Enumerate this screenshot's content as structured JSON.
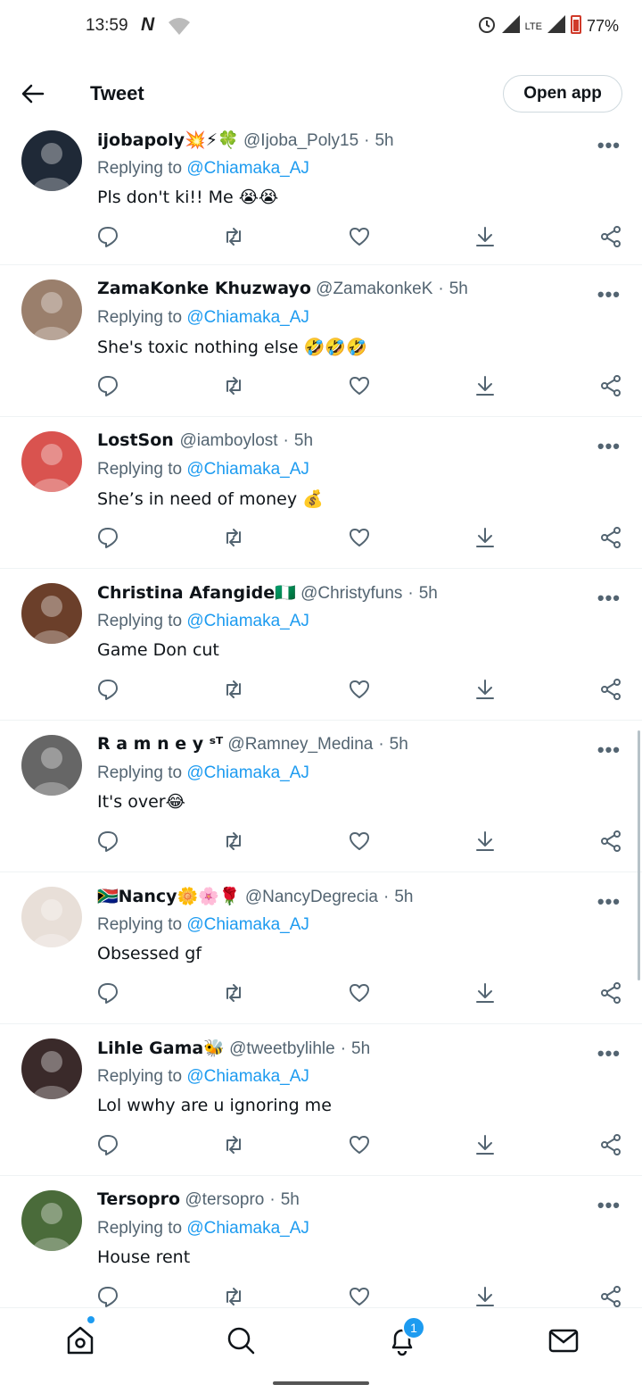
{
  "status_bar": {
    "time": "13:59",
    "network_letter": "N",
    "lte": "LTE",
    "battery": "77%"
  },
  "header": {
    "title": "Tweet",
    "open_app_label": "Open app"
  },
  "tweets": [
    {
      "name": "ijobapoly💥⚡🍀",
      "handle": "@Ijoba_Poly15",
      "time": "5h",
      "replying_prefix": "Replying to",
      "mention": "@Chiamaka_AJ",
      "text": "Pls don't ki!! Me 😭😭",
      "avatar_color": "#1f2937"
    },
    {
      "name": "ZamaKonke Khuzwayo",
      "handle": "@ZamakonkeK",
      "time": "5h",
      "replying_prefix": "Replying to",
      "mention": "@Chiamaka_AJ",
      "text": "She's toxic nothing else 🤣🤣🤣",
      "avatar_color": "#9a7f6c"
    },
    {
      "name": "LostSon ",
      "handle": "@iamboylost",
      "time": "5h",
      "replying_prefix": "Replying to",
      "mention": "@Chiamaka_AJ",
      "text": "She’s in need of money 💰",
      "avatar_color": "#d9534f"
    },
    {
      "name": "Christina Afangide🇳🇬",
      "handle": "@Christyfuns",
      "time": "5h",
      "replying_prefix": "Replying to",
      "mention": "@Chiamaka_AJ",
      "text": "Game Don cut",
      "avatar_color": "#6b3f2a"
    },
    {
      "name": "R a m n e y ˢᵀ",
      "handle": "@Ramney_Medina",
      "time": "5h",
      "replying_prefix": "Replying to",
      "mention": "@Chiamaka_AJ",
      "text": "It's over😂",
      "avatar_color": "#666666"
    },
    {
      "name": "🇿🇦Nancy🌼🌸🌹",
      "handle": "@NancyDegrecia",
      "time": "5h",
      "replying_prefix": "Replying to",
      "mention": "@Chiamaka_AJ",
      "text": "Obsessed gf",
      "avatar_color": "#e8dfd8"
    },
    {
      "name": "Lihle Gama🐝",
      "handle": "@tweetbylihle",
      "time": "5h",
      "replying_prefix": "Replying to",
      "mention": "@Chiamaka_AJ",
      "text": "Lol wwhy are u ignoring me",
      "avatar_color": "#3a2a2a"
    },
    {
      "name": "Tersopro",
      "handle": "@tersopro",
      "time": "5h",
      "replying_prefix": "Replying to",
      "mention": "@Chiamaka_AJ",
      "text": "House rent",
      "avatar_color": "#4a6b3a"
    }
  ],
  "bottom_nav": {
    "notification_count": "1"
  },
  "icons": [
    "back-arrow-icon",
    "reply-icon",
    "retweet-icon",
    "like-icon",
    "download-icon",
    "share-icon",
    "home-icon",
    "search-icon",
    "bell-icon",
    "mail-icon"
  ],
  "colors": {
    "accent": "#1d9bf0",
    "secondary_text": "#536471",
    "divider": "#eff3f4"
  }
}
